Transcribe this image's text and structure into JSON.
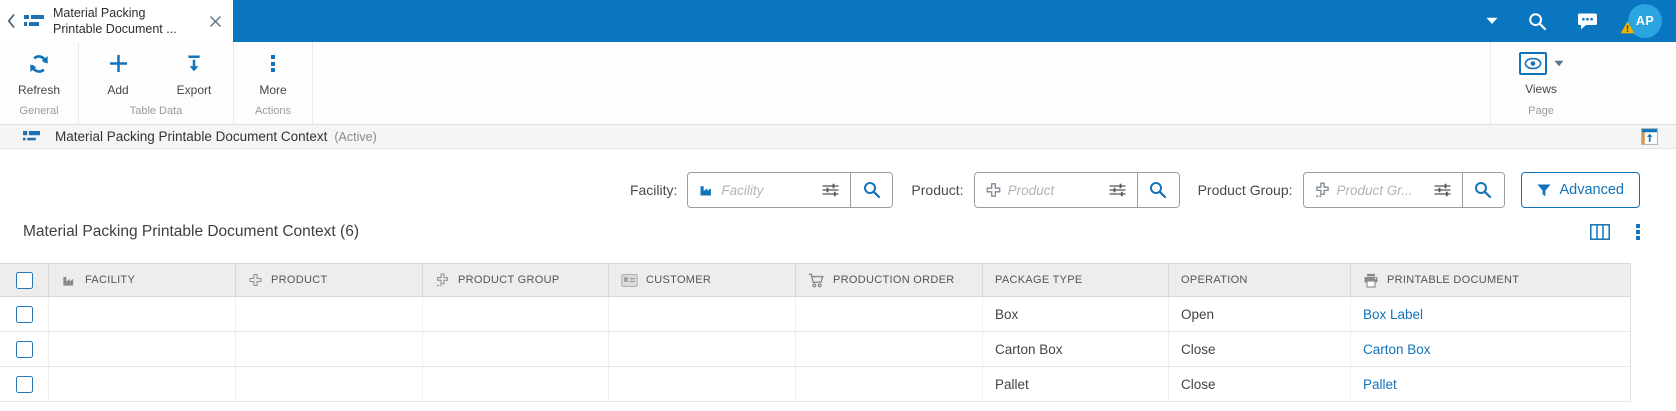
{
  "topbar": {
    "tab": {
      "title_line1": "Material Packing",
      "title_line2": "Printable Document ..."
    },
    "avatar": {
      "initials": "AP"
    }
  },
  "toolbar": {
    "refresh_label": "Refresh",
    "add_label": "Add",
    "export_label": "Export",
    "more_label": "More",
    "group_general": "General",
    "group_table_data": "Table Data",
    "group_actions": "Actions",
    "views_label": "Views",
    "group_page": "Page"
  },
  "page_header": {
    "title": "Material Packing Printable Document Context",
    "status": "(Active)"
  },
  "filters": [
    {
      "label": "Facility:",
      "placeholder": "Facility",
      "icon": "factory-icon"
    },
    {
      "label": "Product:",
      "placeholder": "Product",
      "icon": "product-icon"
    },
    {
      "label": "Product Group:",
      "placeholder": "Product Gr...",
      "icon": "product-group-icon"
    }
  ],
  "advanced_button": {
    "label": "Advanced"
  },
  "table": {
    "title": "Material Packing Printable Document Context (6)",
    "columns": [
      {
        "label": "FACILITY",
        "icon": "factory-icon"
      },
      {
        "label": "PRODUCT",
        "icon": "product-icon"
      },
      {
        "label": "PRODUCT GROUP",
        "icon": "product-group-icon"
      },
      {
        "label": "CUSTOMER",
        "icon": "customer-card-icon"
      },
      {
        "label": "PRODUCTION ORDER",
        "icon": "cart-icon"
      },
      {
        "label": "PACKAGE TYPE",
        "icon": ""
      },
      {
        "label": "OPERATION",
        "icon": ""
      },
      {
        "label": "PRINTABLE DOCUMENT",
        "icon": "printer-icon"
      }
    ],
    "rows": [
      {
        "facility": "",
        "product": "",
        "product_group": "",
        "customer": "",
        "production_order": "",
        "package_type": "Box",
        "operation": "Open",
        "printable_document": "Box Label"
      },
      {
        "facility": "",
        "product": "",
        "product_group": "",
        "customer": "",
        "production_order": "",
        "package_type": "Carton Box",
        "operation": "Close",
        "printable_document": "Carton Box"
      },
      {
        "facility": "",
        "product": "",
        "product_group": "",
        "customer": "",
        "production_order": "",
        "package_type": "Pallet",
        "operation": "Close",
        "printable_document": "Pallet"
      }
    ]
  },
  "colors": {
    "topbar_blue": "#0b76c0",
    "accent_blue": "#1173b9",
    "link_blue": "#1173b9",
    "avatar_blue": "#2aa5e0",
    "warning_yellow": "#f3b200"
  }
}
